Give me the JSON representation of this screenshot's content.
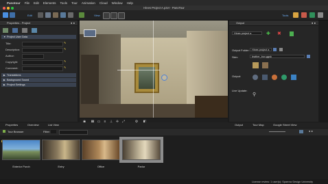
{
  "menubar": {
    "items": [
      "Panotour",
      "File",
      "Edit",
      "Elements",
      "Tools",
      "Tour",
      "Animation",
      "Cloud",
      "Window",
      "Help"
    ]
  },
  "window": {
    "title": "Hines Project A.p2vr - PanoTour"
  },
  "toolbar": {
    "edit_label": "Edit",
    "view_label": "View",
    "tools_label": "Tools",
    "logo_label": "Pano"
  },
  "left_panel": {
    "header": "Properties - Project",
    "section_project_user_data": "Project User Data",
    "fields": [
      {
        "label": "Title:"
      },
      {
        "label": "Description:"
      },
      {
        "label": "Author:"
      },
      {
        "label": "Copyright:"
      },
      {
        "label": "Comment:"
      }
    ],
    "section_translations": "Translations",
    "section_background_sound": "Background Sound",
    "section_project_settings": "Project Settings"
  },
  "right_panel": {
    "header": "Output",
    "output_select": "Hines project a",
    "output_folder_label": "Output Folder:",
    "output_folder_value": "Hines project a",
    "skin_label": "Skin:",
    "skin_value": "leather_box.ggsk",
    "output_label": "Output:",
    "live_update_label": "Live Update:"
  },
  "bottom_tabs": {
    "left": [
      "Properties",
      "Overview",
      "List View"
    ],
    "right": [
      "Output",
      "Tour Map",
      "Google Street View"
    ]
  },
  "tour_browser": {
    "title": "Tour Browser",
    "filter_label": "Filter:",
    "items": [
      {
        "label": "Exterior Porch"
      },
      {
        "label": "Entry"
      },
      {
        "label": "Office"
      },
      {
        "label": "Parlor"
      }
    ],
    "selected_index": 3
  },
  "status": {
    "text": "License review: 1 user(s): Sparrow Design University"
  },
  "colors": {
    "accent": "#3b82f6",
    "section": "#3a4250",
    "pencil": "#e6c84b"
  }
}
